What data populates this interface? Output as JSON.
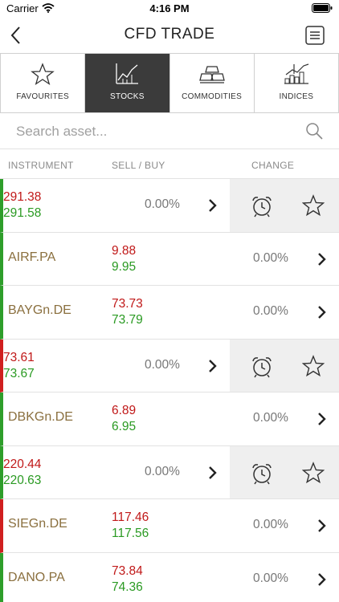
{
  "status": {
    "carrier": "Carrier",
    "time": "4:16 PM"
  },
  "nav": {
    "title": "CFD TRADE"
  },
  "tabs": [
    {
      "label": "FAVOURITES",
      "icon": "star-icon",
      "active": false
    },
    {
      "label": "STOCKS",
      "icon": "stocks-chart-icon",
      "active": true
    },
    {
      "label": "COMMODITIES",
      "icon": "gold-bars-icon",
      "active": false
    },
    {
      "label": "INDICES",
      "icon": "indices-chart-icon",
      "active": false
    }
  ],
  "search": {
    "placeholder": "Search asset..."
  },
  "columns": {
    "instrument": "INSTRUMENT",
    "sell_buy": "SELL / BUY",
    "change": "CHANGE"
  },
  "rows": [
    {
      "name": "",
      "sell": "291.38",
      "buy": "291.58",
      "change": "0.00%",
      "trend": "up",
      "swiped": true
    },
    {
      "name": "AIRF.PA",
      "sell": "9.88",
      "buy": "9.95",
      "change": "0.00%",
      "trend": "up",
      "swiped": false
    },
    {
      "name": "BAYGn.DE",
      "sell": "73.73",
      "buy": "73.79",
      "change": "0.00%",
      "trend": "up",
      "swiped": false
    },
    {
      "name": "",
      "sell": "73.61",
      "buy": "73.67",
      "change": "0.00%",
      "trend": "down",
      "swiped": true
    },
    {
      "name": "DBKGn.DE",
      "sell": "6.89",
      "buy": "6.95",
      "change": "0.00%",
      "trend": "up",
      "swiped": false
    },
    {
      "name": "",
      "sell": "220.44",
      "buy": "220.63",
      "change": "0.00%",
      "trend": "up",
      "swiped": true
    },
    {
      "name": "SIEGn.DE",
      "sell": "117.46",
      "buy": "117.56",
      "change": "0.00%",
      "trend": "down",
      "swiped": false
    },
    {
      "name": "DANO.PA",
      "sell": "73.84",
      "buy": "74.36",
      "change": "0.00%",
      "trend": "up",
      "swiped": false
    }
  ],
  "colors": {
    "sell": "#c01818",
    "buy": "#2a9a22",
    "instrument": "#8a6f3e",
    "active_tab": "#3b3b3b"
  }
}
